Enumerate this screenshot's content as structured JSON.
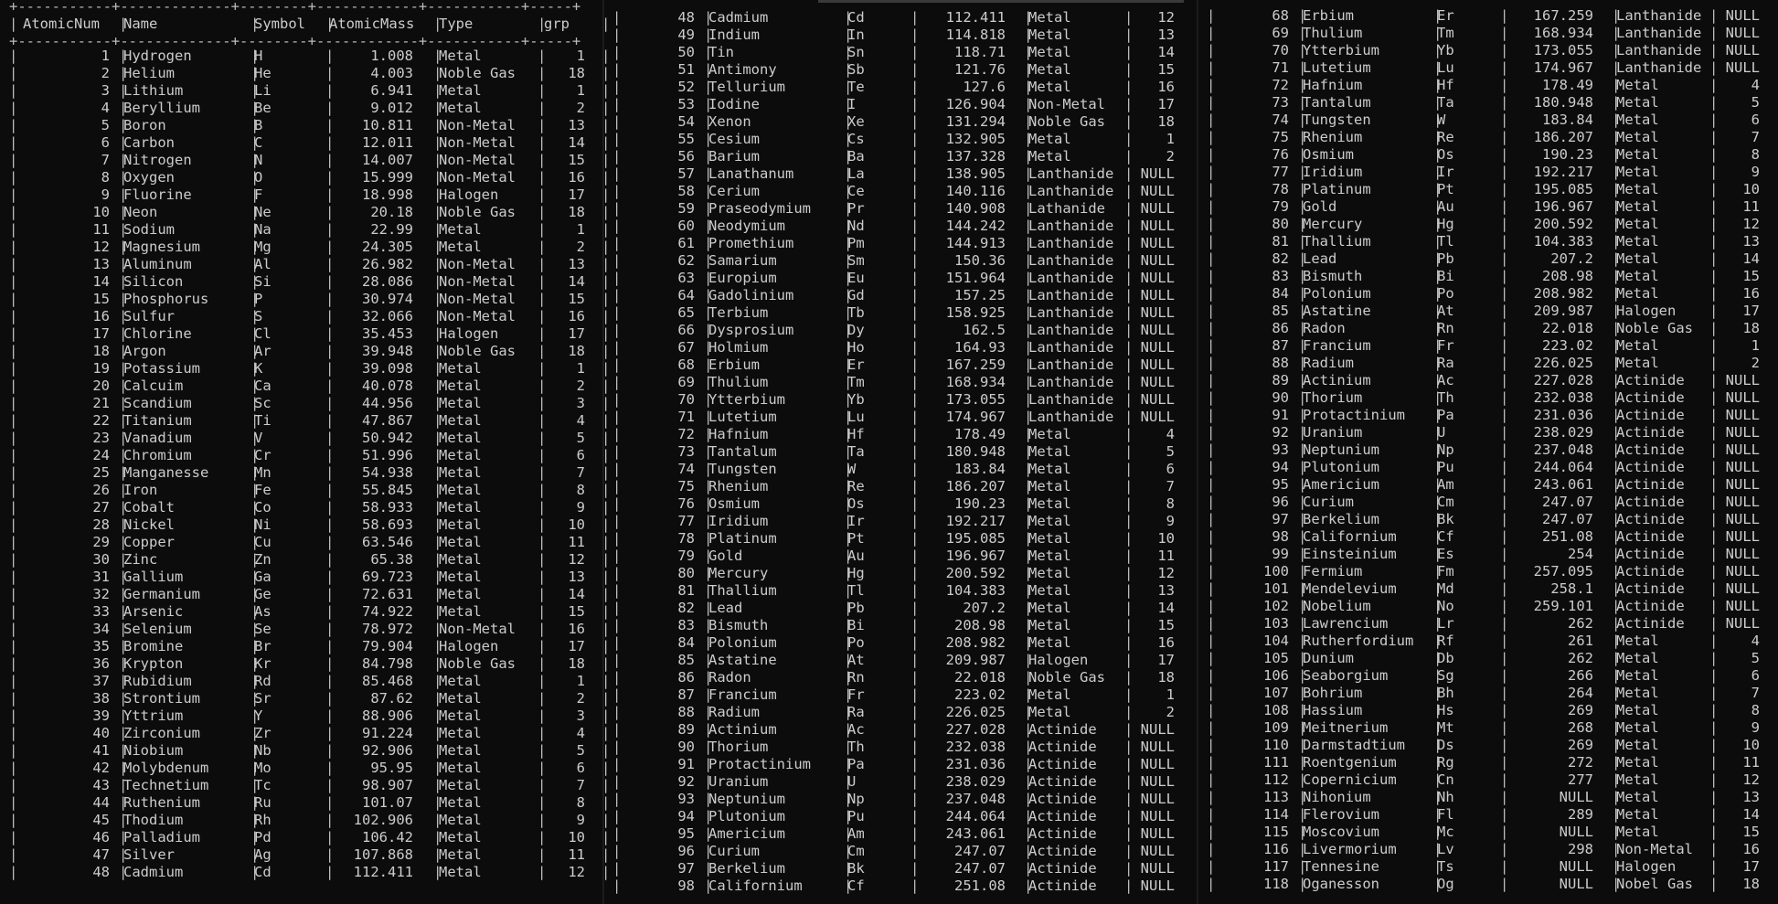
{
  "table": {
    "columns": [
      "AtomicNum",
      "Name",
      "Symbol",
      "AtomicMass",
      "Type",
      "grp"
    ],
    "border_top": "+-----------+-------------+--------+------------+-----------+-----+",
    "pane1_rows": [
      [
        "1",
        "Hydrogen",
        "H",
        "1.008",
        "Metal",
        "1"
      ],
      [
        "2",
        "Helium",
        "He",
        "4.003",
        "Noble Gas",
        "18"
      ],
      [
        "3",
        "Lithium",
        "Li",
        "6.941",
        "Metal",
        "1"
      ],
      [
        "4",
        "Beryllium",
        "Be",
        "9.012",
        "Metal",
        "2"
      ],
      [
        "5",
        "Boron",
        "B",
        "10.811",
        "Non-Metal",
        "13"
      ],
      [
        "6",
        "Carbon",
        "C",
        "12.011",
        "Non-Metal",
        "14"
      ],
      [
        "7",
        "Nitrogen",
        "N",
        "14.007",
        "Non-Metal",
        "15"
      ],
      [
        "8",
        "Oxygen",
        "O",
        "15.999",
        "Non-Metal",
        "16"
      ],
      [
        "9",
        "Fluorine",
        "F",
        "18.998",
        "Halogen",
        "17"
      ],
      [
        "10",
        "Neon",
        "Ne",
        "20.18",
        "Noble Gas",
        "18"
      ],
      [
        "11",
        "Sodium",
        "Na",
        "22.99",
        "Metal",
        "1"
      ],
      [
        "12",
        "Magnesium",
        "Mg",
        "24.305",
        "Metal",
        "2"
      ],
      [
        "13",
        "Aluminum",
        "Al",
        "26.982",
        "Non-Metal",
        "13"
      ],
      [
        "14",
        "Silicon",
        "Si",
        "28.086",
        "Non-Metal",
        "14"
      ],
      [
        "15",
        "Phosphorus",
        "P",
        "30.974",
        "Non-Metal",
        "15"
      ],
      [
        "16",
        "Sulfur",
        "S",
        "32.066",
        "Non-Metal",
        "16"
      ],
      [
        "17",
        "Chlorine",
        "Cl",
        "35.453",
        "Halogen",
        "17"
      ],
      [
        "18",
        "Argon",
        "Ar",
        "39.948",
        "Noble Gas",
        "18"
      ],
      [
        "19",
        "Potassium",
        "K",
        "39.098",
        "Metal",
        "1"
      ],
      [
        "20",
        "Calcuim",
        "Ca",
        "40.078",
        "Metal",
        "2"
      ],
      [
        "21",
        "Scandium",
        "Sc",
        "44.956",
        "Metal",
        "3"
      ],
      [
        "22",
        "Titanium",
        "Ti",
        "47.867",
        "Metal",
        "4"
      ],
      [
        "23",
        "Vanadium",
        "V",
        "50.942",
        "Metal",
        "5"
      ],
      [
        "24",
        "Chromium",
        "Cr",
        "51.996",
        "Metal",
        "6"
      ],
      [
        "25",
        "Manganesse",
        "Mn",
        "54.938",
        "Metal",
        "7"
      ],
      [
        "26",
        "Iron",
        "Fe",
        "55.845",
        "Metal",
        "8"
      ],
      [
        "27",
        "Cobalt",
        "Co",
        "58.933",
        "Metal",
        "9"
      ],
      [
        "28",
        "Nickel",
        "Ni",
        "58.693",
        "Metal",
        "10"
      ],
      [
        "29",
        "Copper",
        "Cu",
        "63.546",
        "Metal",
        "11"
      ],
      [
        "30",
        "Zinc",
        "Zn",
        "65.38",
        "Metal",
        "12"
      ],
      [
        "31",
        "Gallium",
        "Ga",
        "69.723",
        "Metal",
        "13"
      ],
      [
        "32",
        "Germanium",
        "Ge",
        "72.631",
        "Metal",
        "14"
      ],
      [
        "33",
        "Arsenic",
        "As",
        "74.922",
        "Metal",
        "15"
      ],
      [
        "34",
        "Selenium",
        "Se",
        "78.972",
        "Non-Metal",
        "16"
      ],
      [
        "35",
        "Bromine",
        "Br",
        "79.904",
        "Halogen",
        "17"
      ],
      [
        "36",
        "Krypton",
        "Kr",
        "84.798",
        "Noble Gas",
        "18"
      ],
      [
        "37",
        "Rubidium",
        "Rd",
        "85.468",
        "Metal",
        "1"
      ],
      [
        "38",
        "Strontium",
        "Sr",
        "87.62",
        "Metal",
        "2"
      ],
      [
        "39",
        "Yttrium",
        "Y",
        "88.906",
        "Metal",
        "3"
      ],
      [
        "40",
        "Zirconium",
        "Zr",
        "91.224",
        "Metal",
        "4"
      ],
      [
        "41",
        "Niobium",
        "Nb",
        "92.906",
        "Metal",
        "5"
      ],
      [
        "42",
        "Molybdenum",
        "Mo",
        "95.95",
        "Metal",
        "6"
      ],
      [
        "43",
        "Technetium",
        "Tc",
        "98.907",
        "Metal",
        "7"
      ],
      [
        "44",
        "Ruthenium",
        "Ru",
        "101.07",
        "Metal",
        "8"
      ],
      [
        "45",
        "Thodium",
        "Rh",
        "102.906",
        "Metal",
        "9"
      ],
      [
        "46",
        "Palladium",
        "Pd",
        "106.42",
        "Metal",
        "10"
      ],
      [
        "47",
        "Silver",
        "Ag",
        "107.868",
        "Metal",
        "11"
      ],
      [
        "48",
        "Cadmium",
        "Cd",
        "112.411",
        "Metal",
        "12"
      ]
    ],
    "pane2_rows": [
      [
        "48",
        "Cadmium",
        "Cd",
        "112.411",
        "Metal",
        "12"
      ],
      [
        "49",
        "Indium",
        "In",
        "114.818",
        "Metal",
        "13"
      ],
      [
        "50",
        "Tin",
        "Sn",
        "118.71",
        "Metal",
        "14"
      ],
      [
        "51",
        "Antimony",
        "Sb",
        "121.76",
        "Metal",
        "15"
      ],
      [
        "52",
        "Tellurium",
        "Te",
        "127.6",
        "Metal",
        "16"
      ],
      [
        "53",
        "Iodine",
        "I",
        "126.904",
        "Non-Metal",
        "17"
      ],
      [
        "54",
        "Xenon",
        "Xe",
        "131.294",
        "Noble Gas",
        "18"
      ],
      [
        "55",
        "Cesium",
        "Cs",
        "132.905",
        "Metal",
        "1"
      ],
      [
        "56",
        "Barium",
        "Ba",
        "137.328",
        "Metal",
        "2"
      ],
      [
        "57",
        "Lanathanum",
        "La",
        "138.905",
        "Lanthanide",
        "NULL"
      ],
      [
        "58",
        "Cerium",
        "Ce",
        "140.116",
        "Lanthanide",
        "NULL"
      ],
      [
        "59",
        "Praseodymium",
        "Pr",
        "140.908",
        "Lathanide",
        "NULL"
      ],
      [
        "60",
        "Neodymium",
        "Nd",
        "144.242",
        "Lanthanide",
        "NULL"
      ],
      [
        "61",
        "Promethium",
        "Pm",
        "144.913",
        "Lanthanide",
        "NULL"
      ],
      [
        "62",
        "Samarium",
        "Sm",
        "150.36",
        "Lanthanide",
        "NULL"
      ],
      [
        "63",
        "Europium",
        "Eu",
        "151.964",
        "Lanthanide",
        "NULL"
      ],
      [
        "64",
        "Gadolinium",
        "Gd",
        "157.25",
        "Lanthanide",
        "NULL"
      ],
      [
        "65",
        "Terbium",
        "Tb",
        "158.925",
        "Lanthanide",
        "NULL"
      ],
      [
        "66",
        "Dysprosium",
        "Dy",
        "162.5",
        "Lanthanide",
        "NULL"
      ],
      [
        "67",
        "Holmium",
        "Ho",
        "164.93",
        "Lanthanide",
        "NULL"
      ],
      [
        "68",
        "Erbium",
        "Er",
        "167.259",
        "Lanthanide",
        "NULL"
      ],
      [
        "69",
        "Thulium",
        "Tm",
        "168.934",
        "Lanthanide",
        "NULL"
      ],
      [
        "70",
        "Ytterbium",
        "Yb",
        "173.055",
        "Lanthanide",
        "NULL"
      ],
      [
        "71",
        "Lutetium",
        "Lu",
        "174.967",
        "Lanthanide",
        "NULL"
      ],
      [
        "72",
        "Hafnium",
        "Hf",
        "178.49",
        "Metal",
        "4"
      ],
      [
        "73",
        "Tantalum",
        "Ta",
        "180.948",
        "Metal",
        "5"
      ],
      [
        "74",
        "Tungsten",
        "W",
        "183.84",
        "Metal",
        "6"
      ],
      [
        "75",
        "Rhenium",
        "Re",
        "186.207",
        "Metal",
        "7"
      ],
      [
        "76",
        "Osmium",
        "Os",
        "190.23",
        "Metal",
        "8"
      ],
      [
        "77",
        "Iridium",
        "Ir",
        "192.217",
        "Metal",
        "9"
      ],
      [
        "78",
        "Platinum",
        "Pt",
        "195.085",
        "Metal",
        "10"
      ],
      [
        "79",
        "Gold",
        "Au",
        "196.967",
        "Metal",
        "11"
      ],
      [
        "80",
        "Mercury",
        "Hg",
        "200.592",
        "Metal",
        "12"
      ],
      [
        "81",
        "Thallium",
        "Tl",
        "104.383",
        "Metal",
        "13"
      ],
      [
        "82",
        "Lead",
        "Pb",
        "207.2",
        "Metal",
        "14"
      ],
      [
        "83",
        "Bismuth",
        "Bi",
        "208.98",
        "Metal",
        "15"
      ],
      [
        "84",
        "Polonium",
        "Po",
        "208.982",
        "Metal",
        "16"
      ],
      [
        "85",
        "Astatine",
        "At",
        "209.987",
        "Halogen",
        "17"
      ],
      [
        "86",
        "Radon",
        "Rn",
        "22.018",
        "Noble Gas",
        "18"
      ],
      [
        "87",
        "Francium",
        "Fr",
        "223.02",
        "Metal",
        "1"
      ],
      [
        "88",
        "Radium",
        "Ra",
        "226.025",
        "Metal",
        "2"
      ],
      [
        "89",
        "Actinium",
        "Ac",
        "227.028",
        "Actinide",
        "NULL"
      ],
      [
        "90",
        "Thorium",
        "Th",
        "232.038",
        "Actinide",
        "NULL"
      ],
      [
        "91",
        "Protactinium",
        "Pa",
        "231.036",
        "Actinide",
        "NULL"
      ],
      [
        "92",
        "Uranium",
        "U",
        "238.029",
        "Actinide",
        "NULL"
      ],
      [
        "93",
        "Neptunium",
        "Np",
        "237.048",
        "Actinide",
        "NULL"
      ],
      [
        "94",
        "Plutonium",
        "Pu",
        "244.064",
        "Actinide",
        "NULL"
      ],
      [
        "95",
        "Americium",
        "Am",
        "243.061",
        "Actinide",
        "NULL"
      ],
      [
        "96",
        "Curium",
        "Cm",
        "247.07",
        "Actinide",
        "NULL"
      ],
      [
        "97",
        "Berkelium",
        "Bk",
        "247.07",
        "Actinide",
        "NULL"
      ],
      [
        "98",
        "Californium",
        "Cf",
        "251.08",
        "Actinide",
        "NULL"
      ]
    ],
    "pane3_rows": [
      [
        "68",
        "Erbium",
        "Er",
        "167.259",
        "Lanthanide",
        "NULL"
      ],
      [
        "69",
        "Thulium",
        "Tm",
        "168.934",
        "Lanthanide",
        "NULL"
      ],
      [
        "70",
        "Ytterbium",
        "Yb",
        "173.055",
        "Lanthanide",
        "NULL"
      ],
      [
        "71",
        "Lutetium",
        "Lu",
        "174.967",
        "Lanthanide",
        "NULL"
      ],
      [
        "72",
        "Hafnium",
        "Hf",
        "178.49",
        "Metal",
        "4"
      ],
      [
        "73",
        "Tantalum",
        "Ta",
        "180.948",
        "Metal",
        "5"
      ],
      [
        "74",
        "Tungsten",
        "W",
        "183.84",
        "Metal",
        "6"
      ],
      [
        "75",
        "Rhenium",
        "Re",
        "186.207",
        "Metal",
        "7"
      ],
      [
        "76",
        "Osmium",
        "Os",
        "190.23",
        "Metal",
        "8"
      ],
      [
        "77",
        "Iridium",
        "Ir",
        "192.217",
        "Metal",
        "9"
      ],
      [
        "78",
        "Platinum",
        "Pt",
        "195.085",
        "Metal",
        "10"
      ],
      [
        "79",
        "Gold",
        "Au",
        "196.967",
        "Metal",
        "11"
      ],
      [
        "80",
        "Mercury",
        "Hg",
        "200.592",
        "Metal",
        "12"
      ],
      [
        "81",
        "Thallium",
        "Tl",
        "104.383",
        "Metal",
        "13"
      ],
      [
        "82",
        "Lead",
        "Pb",
        "207.2",
        "Metal",
        "14"
      ],
      [
        "83",
        "Bismuth",
        "Bi",
        "208.98",
        "Metal",
        "15"
      ],
      [
        "84",
        "Polonium",
        "Po",
        "208.982",
        "Metal",
        "16"
      ],
      [
        "85",
        "Astatine",
        "At",
        "209.987",
        "Halogen",
        "17"
      ],
      [
        "86",
        "Radon",
        "Rn",
        "22.018",
        "Noble Gas",
        "18"
      ],
      [
        "87",
        "Francium",
        "Fr",
        "223.02",
        "Metal",
        "1"
      ],
      [
        "88",
        "Radium",
        "Ra",
        "226.025",
        "Metal",
        "2"
      ],
      [
        "89",
        "Actinium",
        "Ac",
        "227.028",
        "Actinide",
        "NULL"
      ],
      [
        "90",
        "Thorium",
        "Th",
        "232.038",
        "Actinide",
        "NULL"
      ],
      [
        "91",
        "Protactinium",
        "Pa",
        "231.036",
        "Actinide",
        "NULL"
      ],
      [
        "92",
        "Uranium",
        "U",
        "238.029",
        "Actinide",
        "NULL"
      ],
      [
        "93",
        "Neptunium",
        "Np",
        "237.048",
        "Actinide",
        "NULL"
      ],
      [
        "94",
        "Plutonium",
        "Pu",
        "244.064",
        "Actinide",
        "NULL"
      ],
      [
        "95",
        "Americium",
        "Am",
        "243.061",
        "Actinide",
        "NULL"
      ],
      [
        "96",
        "Curium",
        "Cm",
        "247.07",
        "Actinide",
        "NULL"
      ],
      [
        "97",
        "Berkelium",
        "Bk",
        "247.07",
        "Actinide",
        "NULL"
      ],
      [
        "98",
        "Californium",
        "Cf",
        "251.08",
        "Actinide",
        "NULL"
      ],
      [
        "99",
        "Einsteinium",
        "Es",
        "254",
        "Actinide",
        "NULL"
      ],
      [
        "100",
        "Fermium",
        "Fm",
        "257.095",
        "Actinide",
        "NULL"
      ],
      [
        "101",
        "Mendelevium",
        "Md",
        "258.1",
        "Actinide",
        "NULL"
      ],
      [
        "102",
        "Nobelium",
        "No",
        "259.101",
        "Actinide",
        "NULL"
      ],
      [
        "103",
        "Lawrencium",
        "Lr",
        "262",
        "Actinide",
        "NULL"
      ],
      [
        "104",
        "Rutherfordium",
        "Rf",
        "261",
        "Metal",
        "4"
      ],
      [
        "105",
        "Dunium",
        "Db",
        "262",
        "Metal",
        "5"
      ],
      [
        "106",
        "Seaborgium",
        "Sg",
        "266",
        "Metal",
        "6"
      ],
      [
        "107",
        "Bohrium",
        "Bh",
        "264",
        "Metal",
        "7"
      ],
      [
        "108",
        "Hassium",
        "Hs",
        "269",
        "Metal",
        "8"
      ],
      [
        "109",
        "Meitnerium",
        "Mt",
        "268",
        "Metal",
        "9"
      ],
      [
        "110",
        "Darmstadtium",
        "Ds",
        "269",
        "Metal",
        "10"
      ],
      [
        "111",
        "Roentgenium",
        "Rg",
        "272",
        "Metal",
        "11"
      ],
      [
        "112",
        "Copernicium",
        "Cn",
        "277",
        "Metal",
        "12"
      ],
      [
        "113",
        "Nihonium",
        "Nh",
        "NULL",
        "Metal",
        "13"
      ],
      [
        "114",
        "Flerovium",
        "Fl",
        "289",
        "Metal",
        "14"
      ],
      [
        "115",
        "Moscovium",
        "Mc",
        "NULL",
        "Metal",
        "15"
      ],
      [
        "116",
        "Livermorium",
        "Lv",
        "298",
        "Non-Metal",
        "16"
      ],
      [
        "117",
        "Tennesine",
        "Ts",
        "NULL",
        "Halogen",
        "17"
      ],
      [
        "118",
        "Oganesson",
        "Og",
        "NULL",
        "Nobel Gas",
        "18"
      ]
    ]
  }
}
